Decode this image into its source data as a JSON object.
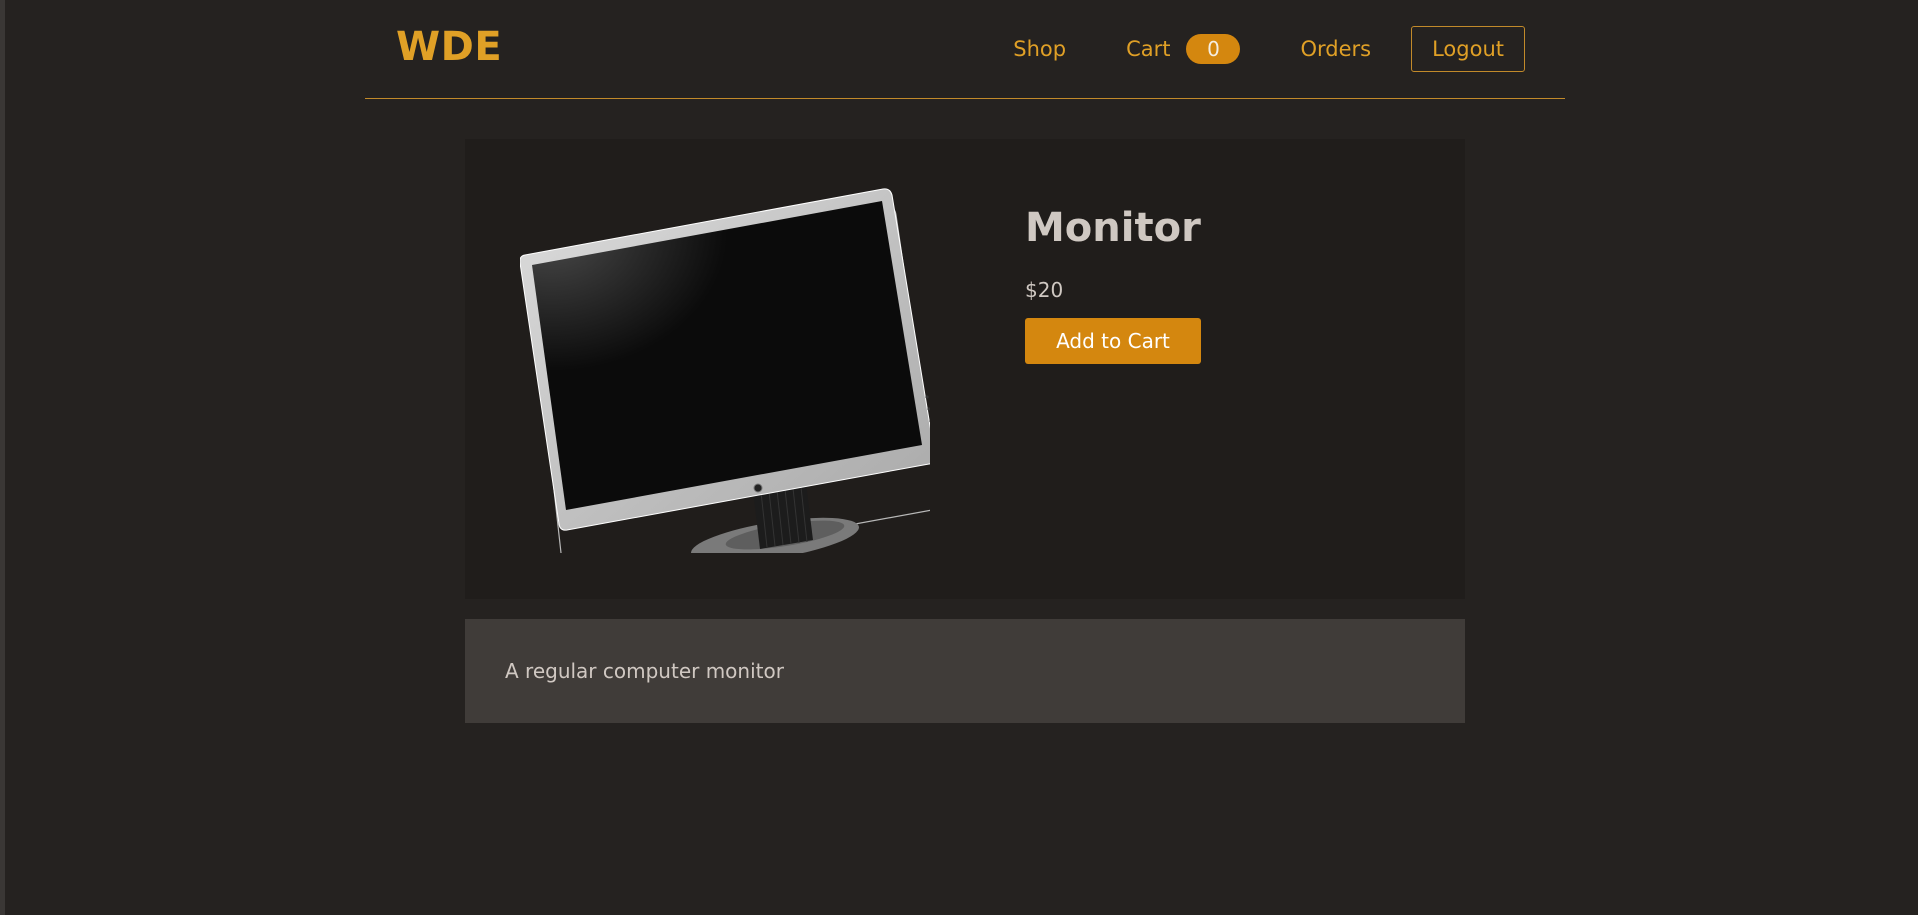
{
  "header": {
    "logo": "WDE",
    "nav": {
      "shop": "Shop",
      "cart": "Cart",
      "cart_count": "0",
      "orders": "Orders",
      "logout": "Logout"
    }
  },
  "product": {
    "title": "Monitor",
    "price": "$20",
    "add_to_cart": "Add to Cart",
    "image_alt": "monitor-image",
    "description": "A regular computer monitor"
  },
  "colors": {
    "accent": "#d4870f",
    "logo": "#e0a026",
    "background": "#252220",
    "card": "#201d1b",
    "description_bg": "#403c39"
  }
}
